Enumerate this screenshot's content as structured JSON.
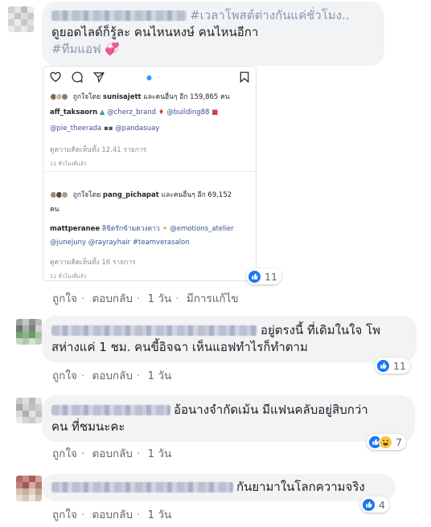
{
  "comments": [
    {
      "text_line1": "#เวลาโพสต์ต่างกันแค่ชั่วโมง..",
      "text_line2": "ดูยอดไลด์ก็รู้ละ คนไหนหงษ์ คนไหนอีกา",
      "hashtag": "#ทีมแอฟ",
      "emoji": "💞",
      "reaction_count": "11",
      "actions": {
        "like": "ถูกใจ",
        "reply": "ตอบกลับ",
        "time": "1 วัน",
        "edited": "มีการแก้ไข"
      }
    },
    {
      "text_line1": "อยู่ตรงนี้ ที่เดิมในใจ โพ",
      "text_line2": "สห่างแค่ 1 ชม. คนขี้อิจฉา เห็นแอฟทำไรก็ทำตาม",
      "reaction_count": "11",
      "actions": {
        "like": "ถูกใจ",
        "reply": "ตอบกลับ",
        "time": "1 วัน"
      }
    },
    {
      "text_line1": "อ้อนางจำกัดเม้น มีแฟนคลับอยู่สิบกว่า",
      "text_line2": "คน ที่ชมนะคะ",
      "reaction_count": "7",
      "actions": {
        "like": "ถูกใจ",
        "reply": "ตอบกลับ",
        "time": "1 วัน"
      }
    },
    {
      "text_line1": "กันยามาในโลกความจริง",
      "reaction_count": "4",
      "actions": {
        "like": "ถูกใจ",
        "reply": "ตอบกลับ",
        "time": "1 วัน"
      }
    }
  ],
  "ig_post": {
    "top": {
      "liked_by_prefix": "ถูกใจโดย",
      "liked_by_user": "sunisajett",
      "liked_by_suffix": "และคนอื่นๆ อีก 159,865 คน",
      "caption_user": "aff_taksaorn",
      "caption_tags_1": "@cherz_brand",
      "caption_tags_2": "@building88",
      "caption_tags_3": "@pie_theerada",
      "caption_tags_4": "@pandasuay",
      "view_comments": "ดูความคิดเห็นทั้ง 12.41 รายการ",
      "time": "12 ชั่วโมงที่แล้ว"
    },
    "bottom": {
      "liked_by_prefix": "ถูกใจโดย",
      "liked_by_user": "pang_pichapat",
      "liked_by_suffix": "และคนอื่นๆ อีก 69,152",
      "liked_by_line2": "คน",
      "caption_user": "mattperanee",
      "caption_text": "ลิขิตรักข้ามดวงดาว",
      "caption_tag_1": "@emotions_atelier",
      "caption_tag_2": "@junejuny",
      "caption_tag_3": "@rayrayhair",
      "caption_tag_4": "#teamverasalon",
      "view_comments": "ดูความคิดเห็นทั้ง 16 รายการ",
      "time": "11 ชั่วโมงที่แล้ว"
    }
  },
  "colors": {
    "bubble_bg": "#f2f3f5",
    "meta_text": "#606770",
    "like_blue": "#1877f2",
    "ig_link": "#38518f"
  }
}
